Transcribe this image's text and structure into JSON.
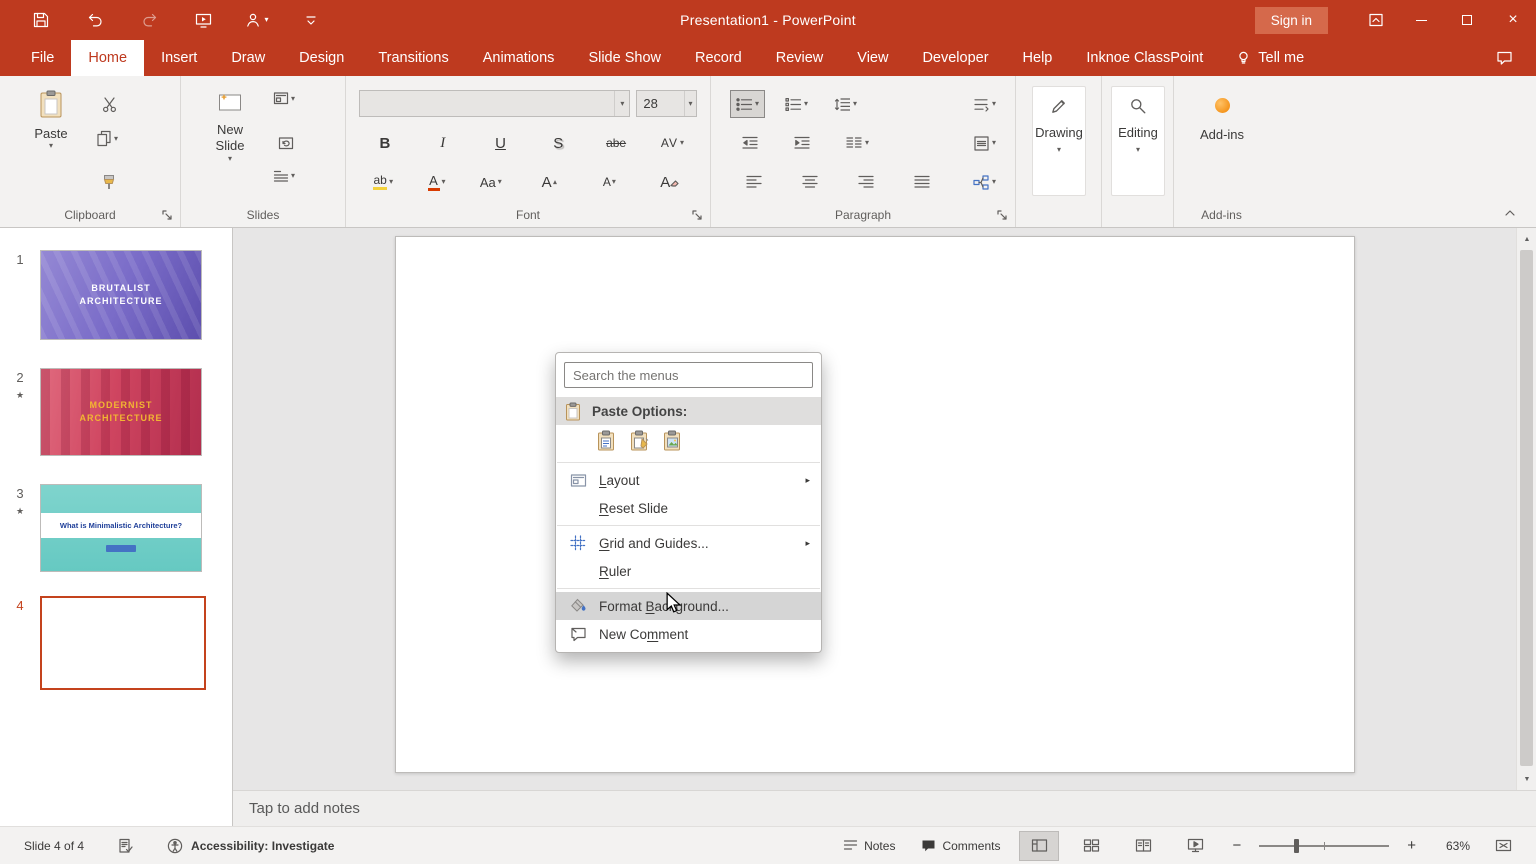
{
  "colors": {
    "brand_red": "#BE3A1F",
    "signin_bg": "#D5694B",
    "ribbon_bg": "#F3F2F1",
    "canvas_bg": "#E7E6E6",
    "selection_red": "#C4431D",
    "menu_highlight": "#D5D5D5",
    "addin_orange": "#F08300"
  },
  "icons": {
    "chevron_down": "▾",
    "submenu_arrow": "▸",
    "scroll_up": "▲",
    "scroll_down": "▼",
    "close": "×",
    "zoom_out": "−",
    "zoom_in": "+",
    "star": "★"
  },
  "titlebar": {
    "title": "Presentation1  -  PowerPoint",
    "sign_in_label": "Sign in"
  },
  "tabs": [
    {
      "label": "File"
    },
    {
      "label": "Home"
    },
    {
      "label": "Insert"
    },
    {
      "label": "Draw"
    },
    {
      "label": "Design"
    },
    {
      "label": "Transitions"
    },
    {
      "label": "Animations"
    },
    {
      "label": "Slide Show"
    },
    {
      "label": "Record"
    },
    {
      "label": "Review"
    },
    {
      "label": "View"
    },
    {
      "label": "Developer"
    },
    {
      "label": "Help"
    },
    {
      "label": "Inknoe ClassPoint"
    }
  ],
  "tell_me_label": "Tell me",
  "ribbon": {
    "clipboard": {
      "label": "Clipboard",
      "paste_label": "Paste"
    },
    "slides": {
      "label": "Slides",
      "new_slide_label": "New Slide"
    },
    "font": {
      "label": "Font",
      "name_value": "",
      "size_value": "28",
      "bold": "B",
      "italic": "I",
      "underline": "U",
      "shadow": "S",
      "strike": "abe",
      "spacing": "AV",
      "highlight": "ab",
      "color": "A",
      "case": "Aa",
      "grow": "A",
      "shrink": "A",
      "clear": "A"
    },
    "paragraph": {
      "label": "Paragraph"
    },
    "drawing": {
      "label": "Drawing"
    },
    "editing": {
      "label": "Editing"
    },
    "addins": {
      "label": "Add-ins",
      "button_label": "Add-ins"
    }
  },
  "slides_panel": {
    "slides": [
      {
        "number": "1",
        "line1": "BRUTALIST",
        "line2": "ARCHITECTURE"
      },
      {
        "number": "2",
        "line1": "MODERNIST",
        "line2": "ARCHITECTURE"
      },
      {
        "number": "3",
        "title": "What is Minimalistic Architecture?"
      },
      {
        "number": "4"
      }
    ]
  },
  "context_menu": {
    "search_placeholder": "Search the menus",
    "paste_options_label": "Paste Options:",
    "items": [
      {
        "label": "&Layout"
      },
      {
        "label": "&Reset Slide"
      },
      {
        "label": "&Grid and Guides..."
      },
      {
        "label": "&Ruler"
      },
      {
        "label": "Format &Background..."
      },
      {
        "label": "New Co&mment"
      }
    ]
  },
  "notes_placeholder": "Tap to add notes",
  "status_bar": {
    "slide_indicator": "Slide 4 of 4",
    "accessibility_label": "Accessibility: Investigate",
    "notes_label": "Notes",
    "comments_label": "Comments",
    "zoom_value": "63%"
  }
}
